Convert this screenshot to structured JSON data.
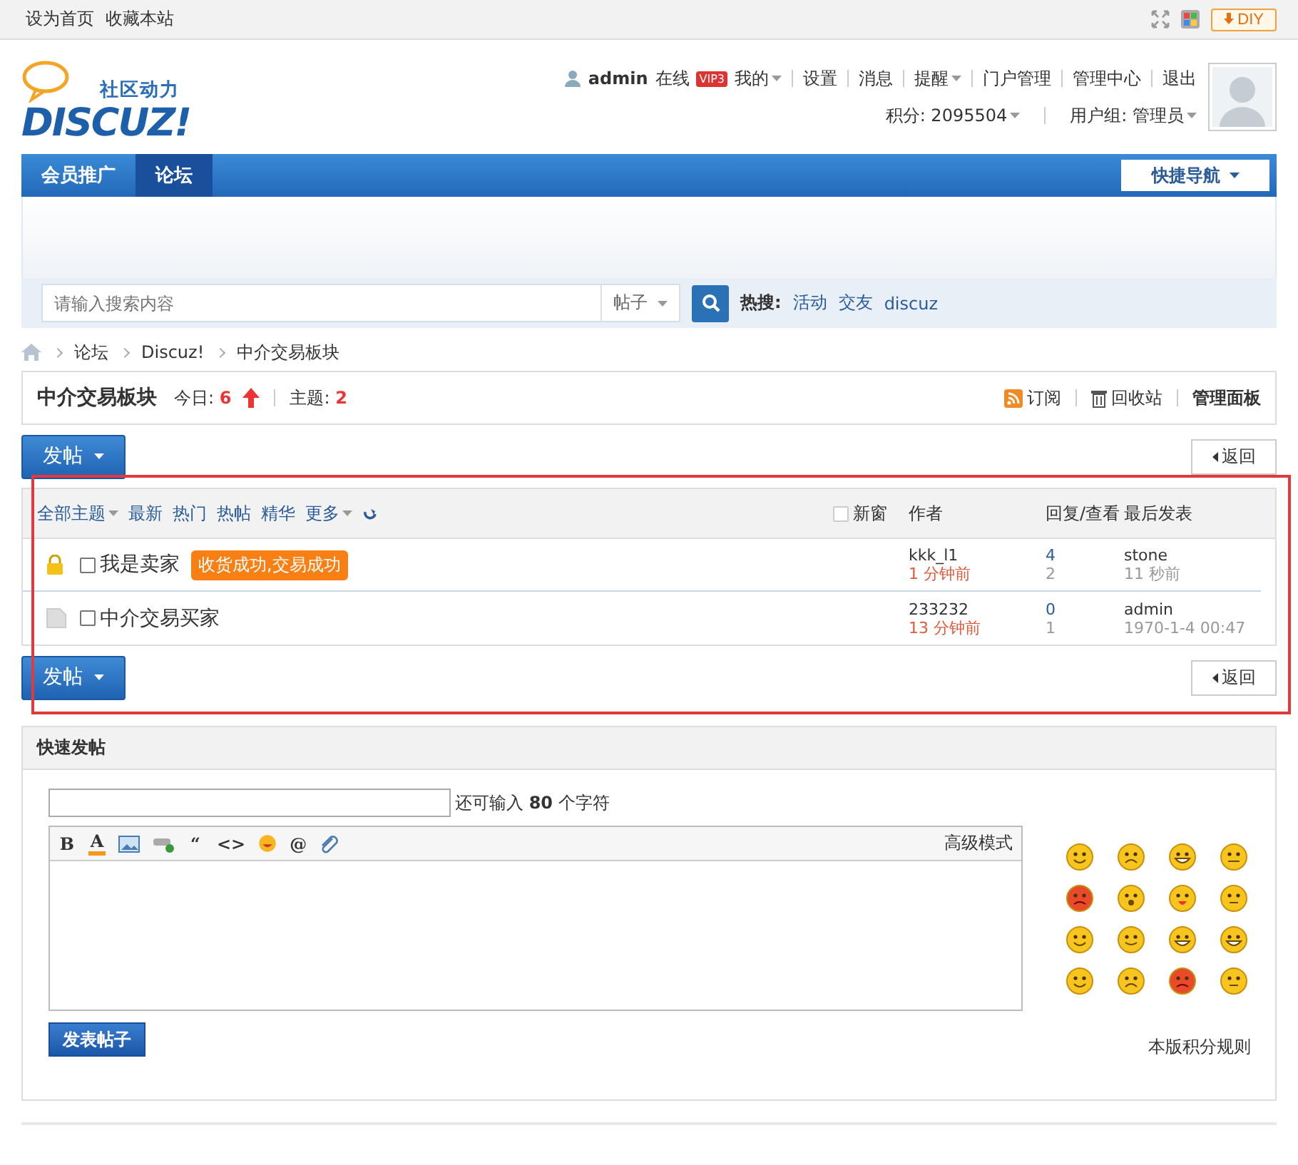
{
  "topbar": {
    "links": [
      "设为首页",
      "收藏本站"
    ],
    "diy": "DIY"
  },
  "logo": {
    "tagline": "社区动力",
    "wordmark": "DISCUZ!"
  },
  "user": {
    "name": "admin",
    "status": "在线",
    "vip": "VIP3",
    "menu": [
      {
        "label": "我的",
        "dropdown": true
      },
      {
        "label": "设置",
        "dropdown": false
      },
      {
        "label": "消息",
        "dropdown": false
      },
      {
        "label": "提醒",
        "dropdown": true
      },
      {
        "label": "门户管理",
        "dropdown": false
      },
      {
        "label": "管理中心",
        "dropdown": false
      },
      {
        "label": "退出",
        "dropdown": false
      }
    ],
    "credits": "积分: 2095504",
    "group": "用户组: 管理员"
  },
  "nav": {
    "items": [
      {
        "label": "会员推广",
        "selected": false
      },
      {
        "label": "论坛",
        "selected": true
      }
    ],
    "quick_nav": "快捷导航"
  },
  "search": {
    "placeholder": "请输入搜索内容",
    "type": "帖子",
    "hot_label": "热搜:",
    "hot": [
      "活动",
      "交友",
      "discuz"
    ]
  },
  "breadcrumb": [
    "论坛",
    "Discuz!",
    "中介交易板块"
  ],
  "forum": {
    "name": "中介交易板块",
    "today_label": "今日:",
    "today": "6",
    "topics_label": "主题:",
    "topics": "2",
    "actions": [
      {
        "kind": "rss",
        "label": "订阅"
      },
      {
        "kind": "trash",
        "label": "回收站"
      },
      {
        "kind": "plain",
        "label": "管理面板"
      }
    ]
  },
  "toolbar_top": {
    "post": "发帖",
    "back": "返回"
  },
  "topic_list": {
    "highlighted": true,
    "filters": [
      {
        "label": "全部主题",
        "dropdown": true
      },
      {
        "label": "最新",
        "dropdown": false
      },
      {
        "label": "热门",
        "dropdown": false
      },
      {
        "label": "热帖",
        "dropdown": false
      },
      {
        "label": "精华",
        "dropdown": false
      },
      {
        "label": "更多",
        "dropdown": true
      }
    ],
    "new_window": {
      "label": "新窗",
      "checked": false
    },
    "columns": [
      "作者",
      "回复/查看",
      "最后发表"
    ],
    "rows": [
      {
        "kind": "locked",
        "title": "我是卖家",
        "checked": false,
        "tag": "收货成功,交易成功",
        "author": "kkk_l1",
        "author_time": "1 分钟前",
        "replies": "4",
        "views": "2",
        "last_user": "stone",
        "last_time": "11 秒前"
      },
      {
        "kind": "normal",
        "title": "中介交易买家",
        "checked": false,
        "author": "233232",
        "author_time": "13 分钟前",
        "replies": "0",
        "views": "1",
        "last_user": "admin",
        "last_time": "1970-1-4 00:47"
      }
    ]
  },
  "toolbar_bottom": {
    "post": "发帖",
    "back": "返回"
  },
  "quick_post": {
    "title": "快速发帖",
    "remaining_prefix": "还可输入",
    "remaining": "80",
    "remaining_suffix": "个字符",
    "tools": [
      {
        "kind": "text",
        "label": "B"
      },
      {
        "kind": "color",
        "label": "A"
      },
      {
        "kind": "image"
      },
      {
        "kind": "link"
      },
      {
        "kind": "text",
        "label": "“"
      },
      {
        "kind": "text",
        "label": "<>"
      },
      {
        "kind": "emoji"
      },
      {
        "kind": "text",
        "label": "@"
      },
      {
        "kind": "attach"
      }
    ],
    "advanced": "高级模式",
    "smilies": [
      {
        "kind": "smile"
      },
      {
        "kind": "sad"
      },
      {
        "kind": "grin"
      },
      {
        "kind": "cry"
      },
      {
        "kind": "angry"
      },
      {
        "kind": "surprised"
      },
      {
        "kind": "tongue"
      },
      {
        "kind": "smug"
      },
      {
        "kind": "smile"
      },
      {
        "kind": "wink"
      },
      {
        "kind": "grin"
      },
      {
        "kind": "grin"
      },
      {
        "kind": "smile"
      },
      {
        "kind": "sad"
      },
      {
        "kind": "angry"
      },
      {
        "kind": "smug"
      }
    ],
    "submit": "发表帖子",
    "rules": "本版积分规则"
  }
}
